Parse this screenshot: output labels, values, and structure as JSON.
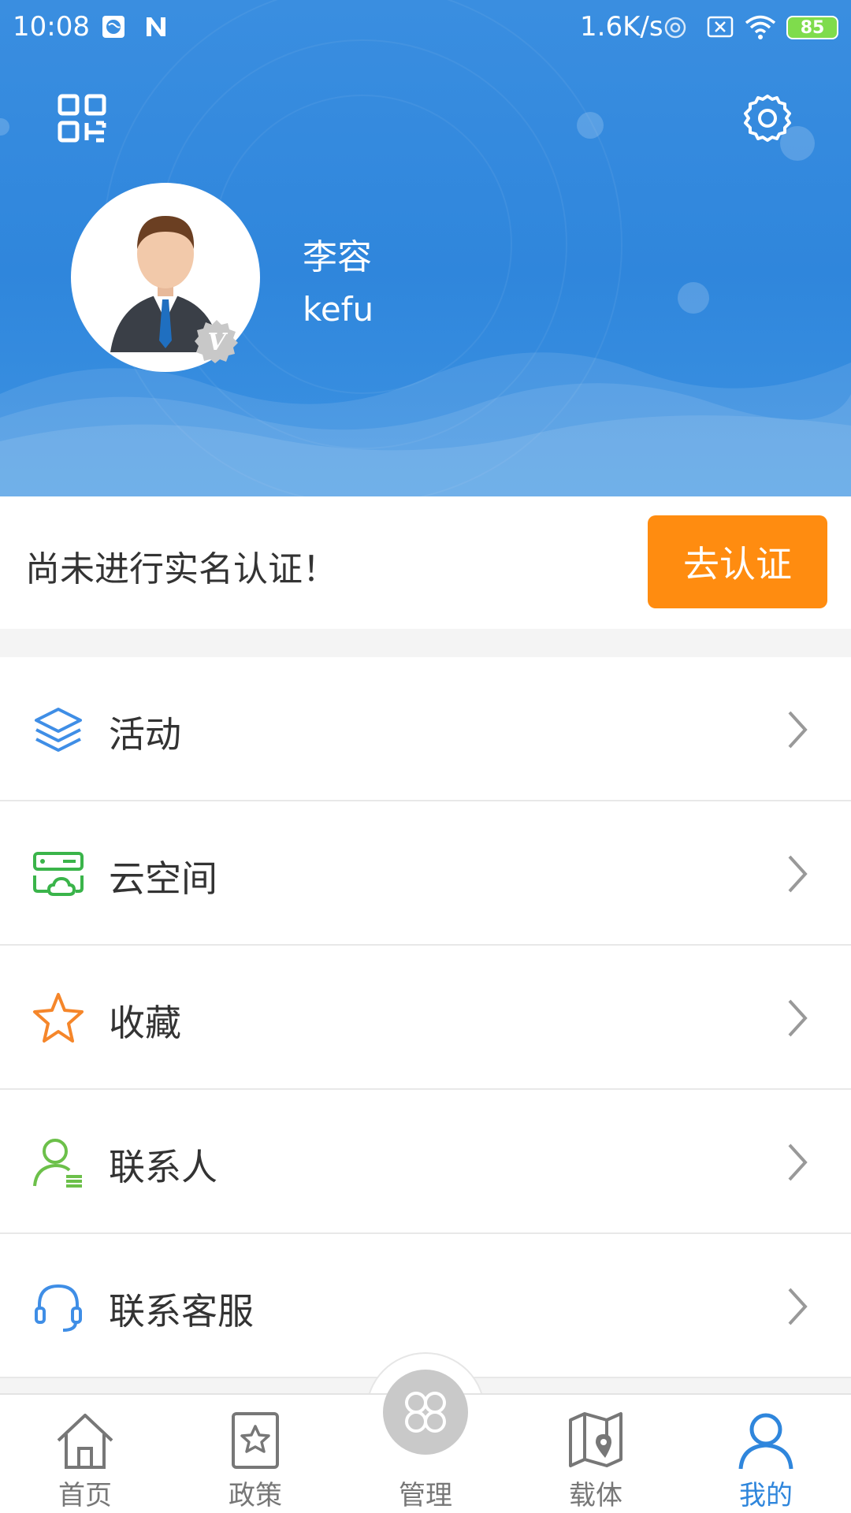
{
  "status_bar": {
    "time": "10:08",
    "speed": "1.6K/s",
    "battery": "85"
  },
  "profile": {
    "name": "李容",
    "account": "kefu"
  },
  "verify": {
    "text": "尚未进行实名认证！",
    "button_label": "去认证"
  },
  "menu": {
    "items": [
      {
        "label": "活动",
        "icon": "layers-icon"
      },
      {
        "label": "云空间",
        "icon": "cloud-server-icon"
      },
      {
        "label": "收藏",
        "icon": "star-icon"
      },
      {
        "label": "联系人",
        "icon": "contact-icon"
      },
      {
        "label": "联系客服",
        "icon": "headset-icon"
      }
    ]
  },
  "bottom_nav": {
    "items": [
      {
        "label": "首页",
        "icon": "home-icon"
      },
      {
        "label": "政策",
        "icon": "policy-icon"
      },
      {
        "label": "管理",
        "icon": "clover-icon"
      },
      {
        "label": "载体",
        "icon": "map-icon"
      },
      {
        "label": "我的",
        "icon": "user-icon"
      }
    ],
    "active_index": 4
  },
  "colors": {
    "header_blue": "#2f86dc",
    "accent_orange": "#ff8c10",
    "active_blue": "#2f86dc"
  }
}
